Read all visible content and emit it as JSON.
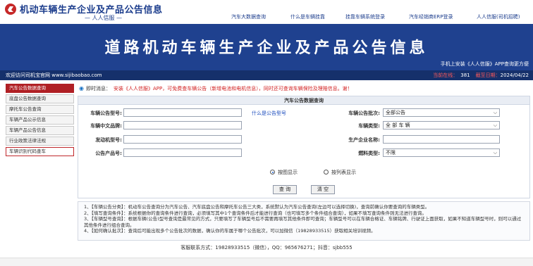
{
  "header": {
    "site_title": "机动车辆生产企业及产品公告信息",
    "site_subtitle": "— 人人信服 —",
    "nav": [
      "汽车大数据查询",
      "什么是车辆挂靠",
      "挂靠车辆系统登录",
      "汽车经销商ERP登录",
      "人人信服(司机招聘)"
    ]
  },
  "banner": {
    "title": "道路机动车辆生产企业及产品公告信息",
    "note": "手机上安装《人人信服》APP查询更方便"
  },
  "strip": {
    "welcome": "欢迎访问司机宝官网 www.sijibaobao.com",
    "visits_label": "当前在线：",
    "visits_value": "381",
    "date_label": "截至日期：",
    "date_value": "2024/04/22"
  },
  "sidebar": {
    "items": [
      {
        "label": "汽车公告数据查询"
      },
      {
        "label": "底盘公告数据查询"
      },
      {
        "label": "摩托车公告查询"
      },
      {
        "label": "车辆产品公示信息"
      },
      {
        "label": "车辆产品公告信息"
      },
      {
        "label": "行业政策法律法规"
      },
      {
        "label": "车辆识别代码查车"
      }
    ]
  },
  "notice": {
    "label": "即时消息：",
    "text": "安装《人人信服》APP，可免费查车辆公告（新增电池和电机信息），同时还可查询车辆保险及理赔信息。谢！"
  },
  "form": {
    "title": "汽车公告数据查询",
    "fields": {
      "batch_no_label": "车辆公告型号:",
      "what_is_model_link": "什么是公告型号",
      "batch_label": "车辆公告批次:",
      "batch_value": "全部公告",
      "brand_label": "车辆中文品牌:",
      "vehicle_type_label": "车辆类型:",
      "vehicle_type_value": "全 部 车 辆",
      "engine_label": "发动机型号:",
      "company_label": "生产企业名称:",
      "product_no_label": "公告产品号:",
      "fuel_label": "燃料类型:",
      "fuel_value": "不限"
    },
    "radios": [
      "按图显示",
      "按列表显示"
    ],
    "buttons": {
      "search": "查 询",
      "clear": "清 空"
    }
  },
  "help": {
    "lines": [
      "1、【车辆公告分类】：机动车公告查询分为汽车公告、汽车底盘公告和摩托车公告三大类，系统默认为汽车公告查询(左边可以选择切换)，查询前确认你要查询的车辆类型。",
      "2、【填写查询条件】：系统根据你的查询条件进行查询，必须填写其中1个查询条件后才能进行查询（也可填写多个条件组合查询），如果不填写查询条件则无法进行查询。",
      "3、【车辆型号查询】：根据车辆(公告)型号查询是最常见的方式，只要填写了车辆型号后不需要再填写其他条件即可查询；车辆型号可以在车辆合格证、车辆铭牌、行驶证上面获取，如果不知道车辆型号时，则可以通过其他条件进行组合查询。",
      "4、【如何确认批次】：查询后可能出现多个公告批次的数据，确认你的车属于哪个公告批次，可以加微信（19828933515）获取相关培训视频。"
    ]
  },
  "footer": {
    "text": "客服联系方式：19828933515（微信），QQ：965676271；抖音：sjbb555"
  }
}
